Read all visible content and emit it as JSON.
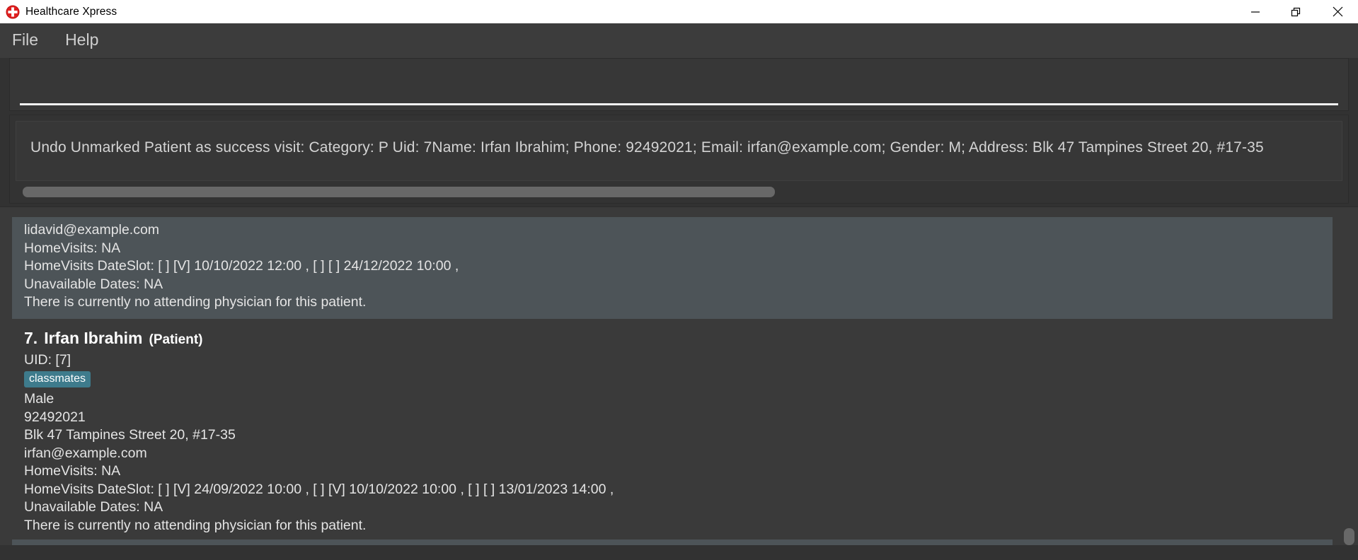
{
  "window": {
    "title": "Healthcare Xpress",
    "icon": "medical-cross-icon",
    "controls": {
      "minimize": "minimize-icon",
      "restore": "restore-icon",
      "close": "close-icon"
    }
  },
  "menubar": {
    "items": [
      {
        "label": "File"
      },
      {
        "label": "Help"
      }
    ]
  },
  "command": {
    "value": "",
    "placeholder": ""
  },
  "result": {
    "text": "Undo Unmarked Patient as success visit: Category: P Uid: 7Name: Irfan Ibrahim; Phone: 92492021; Email: irfan@example.com; Gender: M; Address: Blk 47 Tampines Street 20, #17-35",
    "hscroll": {
      "position": "left"
    }
  },
  "person_list": {
    "cards": [
      {
        "selected": true,
        "partial": true,
        "email": "lidavid@example.com",
        "home_visits": "HomeVisits: NA",
        "home_visits_dateslot": "HomeVisits DateSlot: [ ] [V] 10/10/2022 12:00 , [ ] [ ] 24/12/2022 10:00 ,",
        "unavailable_dates": "Unavailable Dates: NA",
        "physician": "There is currently no attending physician for this patient."
      },
      {
        "selected": false,
        "partial": false,
        "index": "7.",
        "name": "Irfan Ibrahim",
        "role": "(Patient)",
        "uid": "UID: [7]",
        "tags": [
          "classmates"
        ],
        "gender": "Male",
        "phone": "92492021",
        "address": "Blk 47 Tampines Street 20, #17-35",
        "email": "irfan@example.com",
        "home_visits": "HomeVisits: NA",
        "home_visits_dateslot": "HomeVisits DateSlot: [ ] [V] 24/09/2022 10:00 , [ ] [V] 10/10/2022 10:00 , [ ] [ ] 13/01/2023 14:00 ,",
        "unavailable_dates": "Unavailable Dates: NA",
        "physician": "There is currently no attending physician for this patient."
      }
    ]
  },
  "colors": {
    "accent_tag": "#3e7b8c",
    "icon_red": "#e02020",
    "selected_card": "#4d5458",
    "background": "#3a3a3a"
  }
}
